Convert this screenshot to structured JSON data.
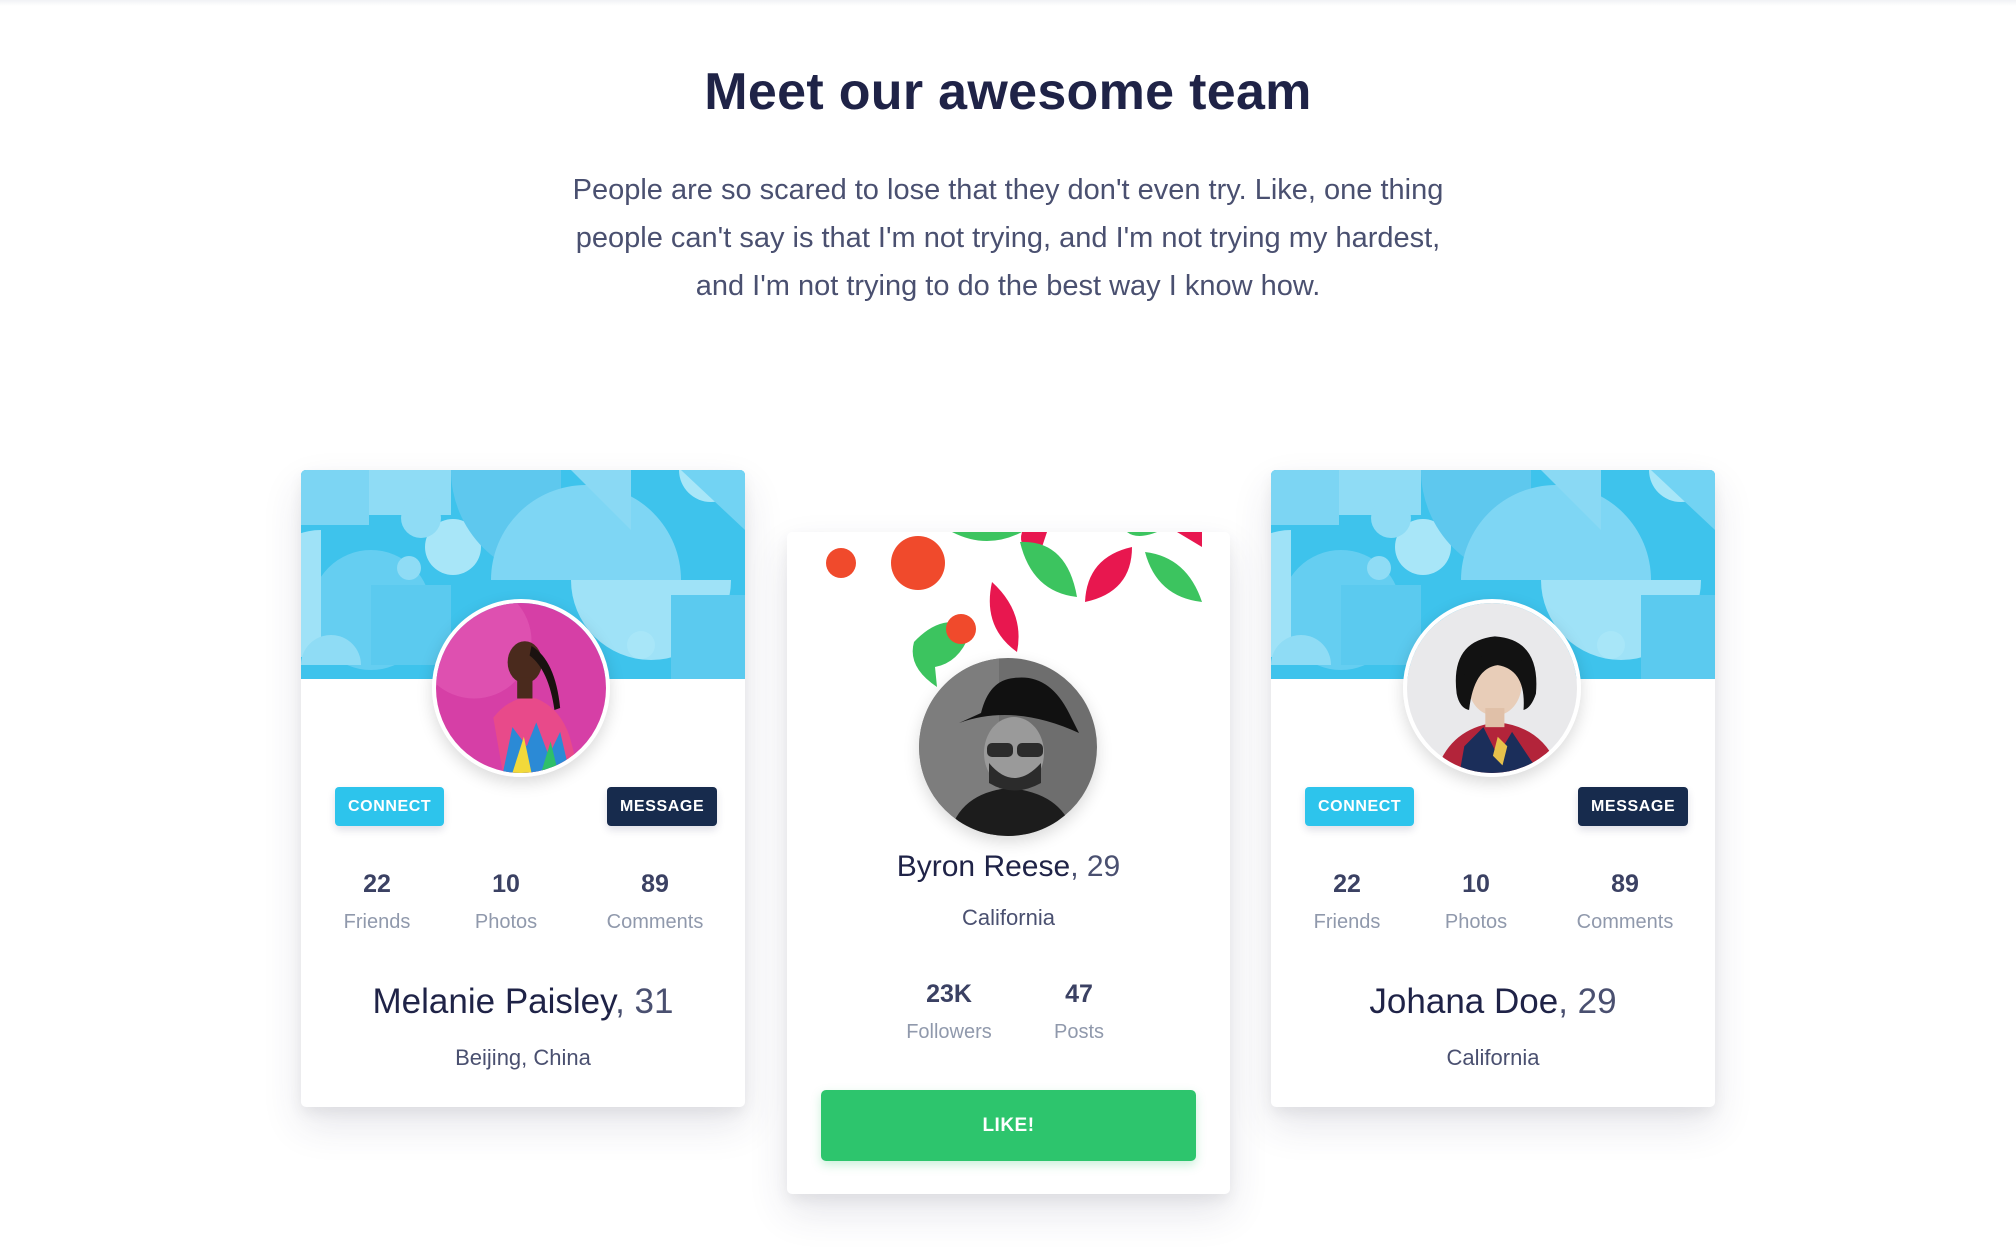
{
  "section": {
    "title": "Meet our awesome team",
    "lead": "People are so scared to lose that they don't even try. Like, one thing people can't say is that I'm not trying, and I'm not trying my hardest, and I'm not trying to do the best way I know how."
  },
  "cards": {
    "left": {
      "connect_label": "CONNECT",
      "message_label": "MESSAGE",
      "stats": [
        {
          "value": "22",
          "label": "Friends"
        },
        {
          "value": "10",
          "label": "Photos"
        },
        {
          "value": "89",
          "label": "Comments"
        }
      ],
      "name": "Melanie Paisley",
      "age": ", 31",
      "location": "Beijing, China",
      "avatar_icon": "profile-photo-woman-pink-background"
    },
    "middle": {
      "name": "Byron Reese",
      "age": ", 29",
      "location": "California",
      "stats": [
        {
          "value": "23K",
          "label": "Followers"
        },
        {
          "value": "47",
          "label": "Posts"
        }
      ],
      "like_label": "LIKE!",
      "avatar_icon": "profile-photo-man-hat-grayscale"
    },
    "right": {
      "connect_label": "CONNECT",
      "message_label": "MESSAGE",
      "stats": [
        {
          "value": "22",
          "label": "Friends"
        },
        {
          "value": "10",
          "label": "Photos"
        },
        {
          "value": "89",
          "label": "Comments"
        }
      ],
      "name": "Johana Doe",
      "age": ", 29",
      "location": "California",
      "avatar_icon": "profile-photo-woman-black-bob"
    }
  },
  "colors": {
    "title": "#1f2347",
    "banner": "#3ec3ec",
    "connect": "#2dc4ec",
    "message": "#172b4d",
    "like": "#2dc56d",
    "leaf_green": "#3cc45f",
    "leaf_red": "#e8174f",
    "dot_orange": "#f04a2c"
  }
}
